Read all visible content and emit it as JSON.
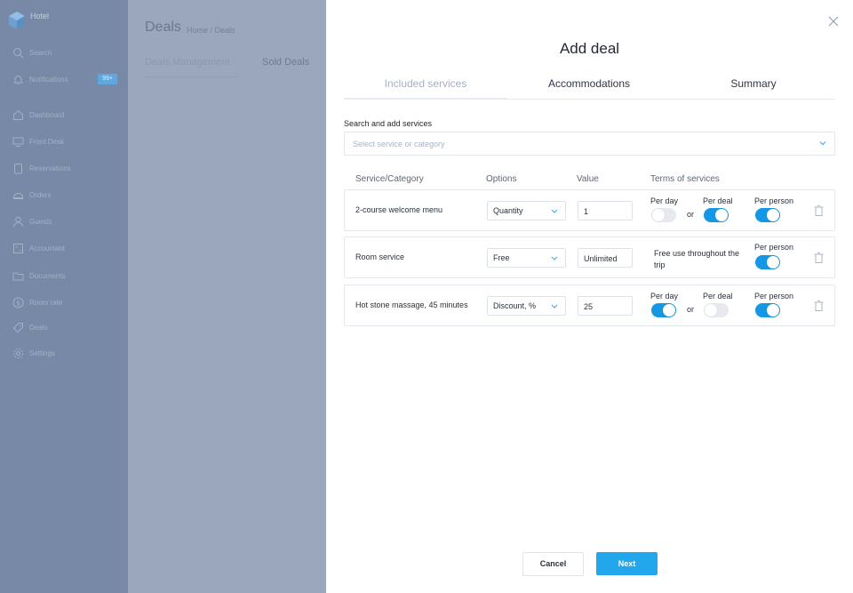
{
  "sidebar": {
    "brand": "Hotel",
    "items": [
      {
        "label": "Search",
        "icon": "search-icon"
      },
      {
        "label": "Notifications",
        "icon": "bell-icon",
        "badge": "99+"
      },
      {
        "label": "Dashboard",
        "icon": "home-icon"
      },
      {
        "label": "Front Desk",
        "icon": "monitor-icon"
      },
      {
        "label": "Reservations",
        "icon": "clipboard-icon"
      },
      {
        "label": "Orders",
        "icon": "cloche-icon"
      },
      {
        "label": "Guests",
        "icon": "user-icon"
      },
      {
        "label": "Accountant",
        "icon": "calculator-icon"
      },
      {
        "label": "Documents",
        "icon": "folder-icon"
      },
      {
        "label": "Room rate",
        "icon": "dollar-icon"
      },
      {
        "label": "Deals",
        "icon": "tag-icon"
      },
      {
        "label": "Settings",
        "icon": "gear-icon"
      }
    ]
  },
  "background_page": {
    "title": "Deals",
    "breadcrumb": "Home / Deals",
    "tabs": [
      "Deals Management",
      "Sold Deals"
    ]
  },
  "modal": {
    "title": "Add deal",
    "tabs": [
      "Included services",
      "Accommodations",
      "Summary"
    ],
    "active_tab": "Included services",
    "search": {
      "label": "Search and add services",
      "placeholder": "Select service or category"
    },
    "columns": [
      "Service/Category",
      "Options",
      "Value",
      "Terms of services"
    ],
    "rows": [
      {
        "service": "2-course welcome menu",
        "option": "Quantity",
        "value": "1",
        "per_day_label": "Per day",
        "per_day": false,
        "or": "or",
        "per_deal_label": "Per deal",
        "per_deal": true,
        "per_person_label": "Per person",
        "per_person": true
      },
      {
        "service": "Room service",
        "option": "Free",
        "value": "Unlimited",
        "terms_text": "Free use throughout the trip",
        "per_person_label": "Per person",
        "per_person": true
      },
      {
        "service": "Hot stone massage, 45 minutes",
        "option": "Discount, %",
        "value": "25",
        "per_day_label": "Per day",
        "per_day": true,
        "or": "or",
        "per_deal_label": "Per deal",
        "per_deal": false,
        "per_person_label": "Per person",
        "per_person": true
      }
    ],
    "cancel_label": "Cancel",
    "next_label": "Next"
  },
  "colors": {
    "accent": "#1597e5",
    "next_button": "#23a7ec",
    "sidebar_overlay": "#7789a6",
    "page_overlay": "#9aa7bd"
  }
}
